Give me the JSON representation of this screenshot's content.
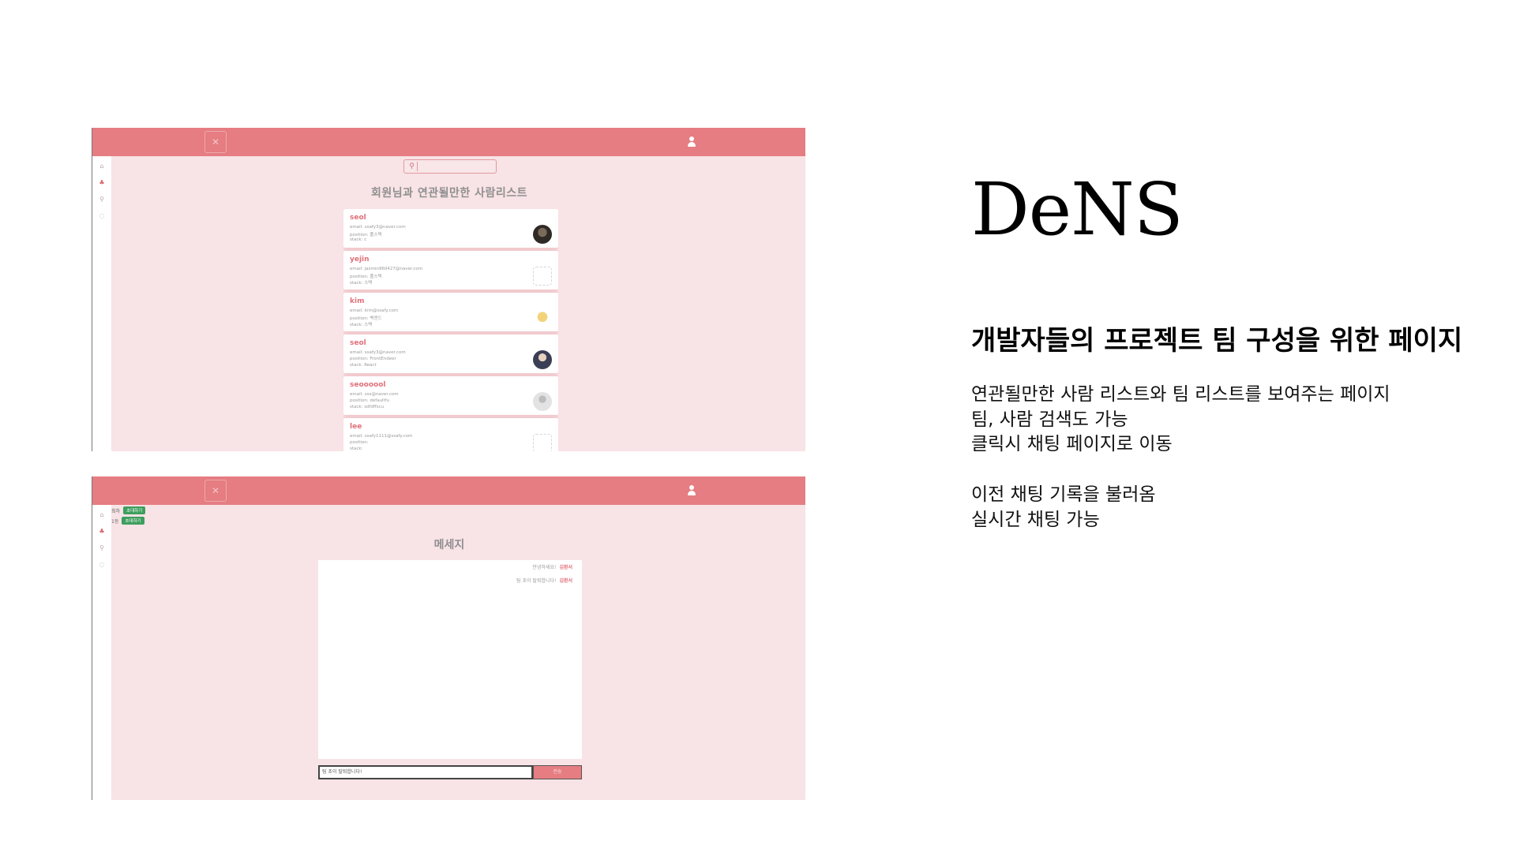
{
  "brand": {
    "title": "DeNS"
  },
  "subtitle": "개발자들의 프로젝트 팀 구성을 위한 페이지",
  "description": {
    "line1": "연관될만한 사람 리스트와 팀 리스트를 보여주는 페이지",
    "line2": "팀, 사람 검색도 가능",
    "line3": "클릭시 채팅 페이지로 이동",
    "line4": "이전 채팅 기록을 불러옴",
    "line5": "실시간 채팅 가능"
  },
  "colors": {
    "accent": "#e57d82",
    "page_bg": "#f8e3e6",
    "invite": "#3d9e5d"
  },
  "screen1": {
    "heading": "회원님과 연관될만한 사람리스트",
    "search_icon": "search-icon",
    "people": [
      {
        "name": "seol",
        "email": "email: ssafy3@naver.com",
        "position": "position: 풀스택",
        "stack": "stack: c",
        "avatar": "av-dark"
      },
      {
        "name": "yejin",
        "email": "email: jasmin960427@naver.com",
        "position": "position: 풀스택",
        "stack": "stack: 스택",
        "avatar": "av-sketch"
      },
      {
        "name": "kim",
        "email": "email: kim@ssafy.com",
        "position": "position: 백엔드",
        "stack": "stack: 스택",
        "avatar": "av-cartoon"
      },
      {
        "name": "seol",
        "email": "email: ssafy3@naver.com",
        "position": "position: FrontEndeer",
        "stack": "stack: React",
        "avatar": "av-photo"
      },
      {
        "name": "seoooool",
        "email": "email: sss@naver.com",
        "position": "position: defaultfu",
        "stack": "stack: sdfdffscu",
        "avatar": "av-default"
      },
      {
        "name": "lee",
        "email": "email: ssafy1111@ssafy.com",
        "position": "position:",
        "stack": "stack:",
        "avatar": "av-sketch"
      }
    ]
  },
  "screen2": {
    "heading": "메세지",
    "invites": [
      {
        "name": "최하",
        "button": "초대하기"
      },
      {
        "name": "1등",
        "button": "초대하기"
      }
    ],
    "messages": [
      {
        "text": "안녕하세요!",
        "sender": "김환서"
      },
      {
        "text": "팀 초이 탈퇴합니다!",
        "sender": "김환서"
      }
    ],
    "input_value": "팀 초이 탈퇴합니다!",
    "send_label": "전송"
  }
}
